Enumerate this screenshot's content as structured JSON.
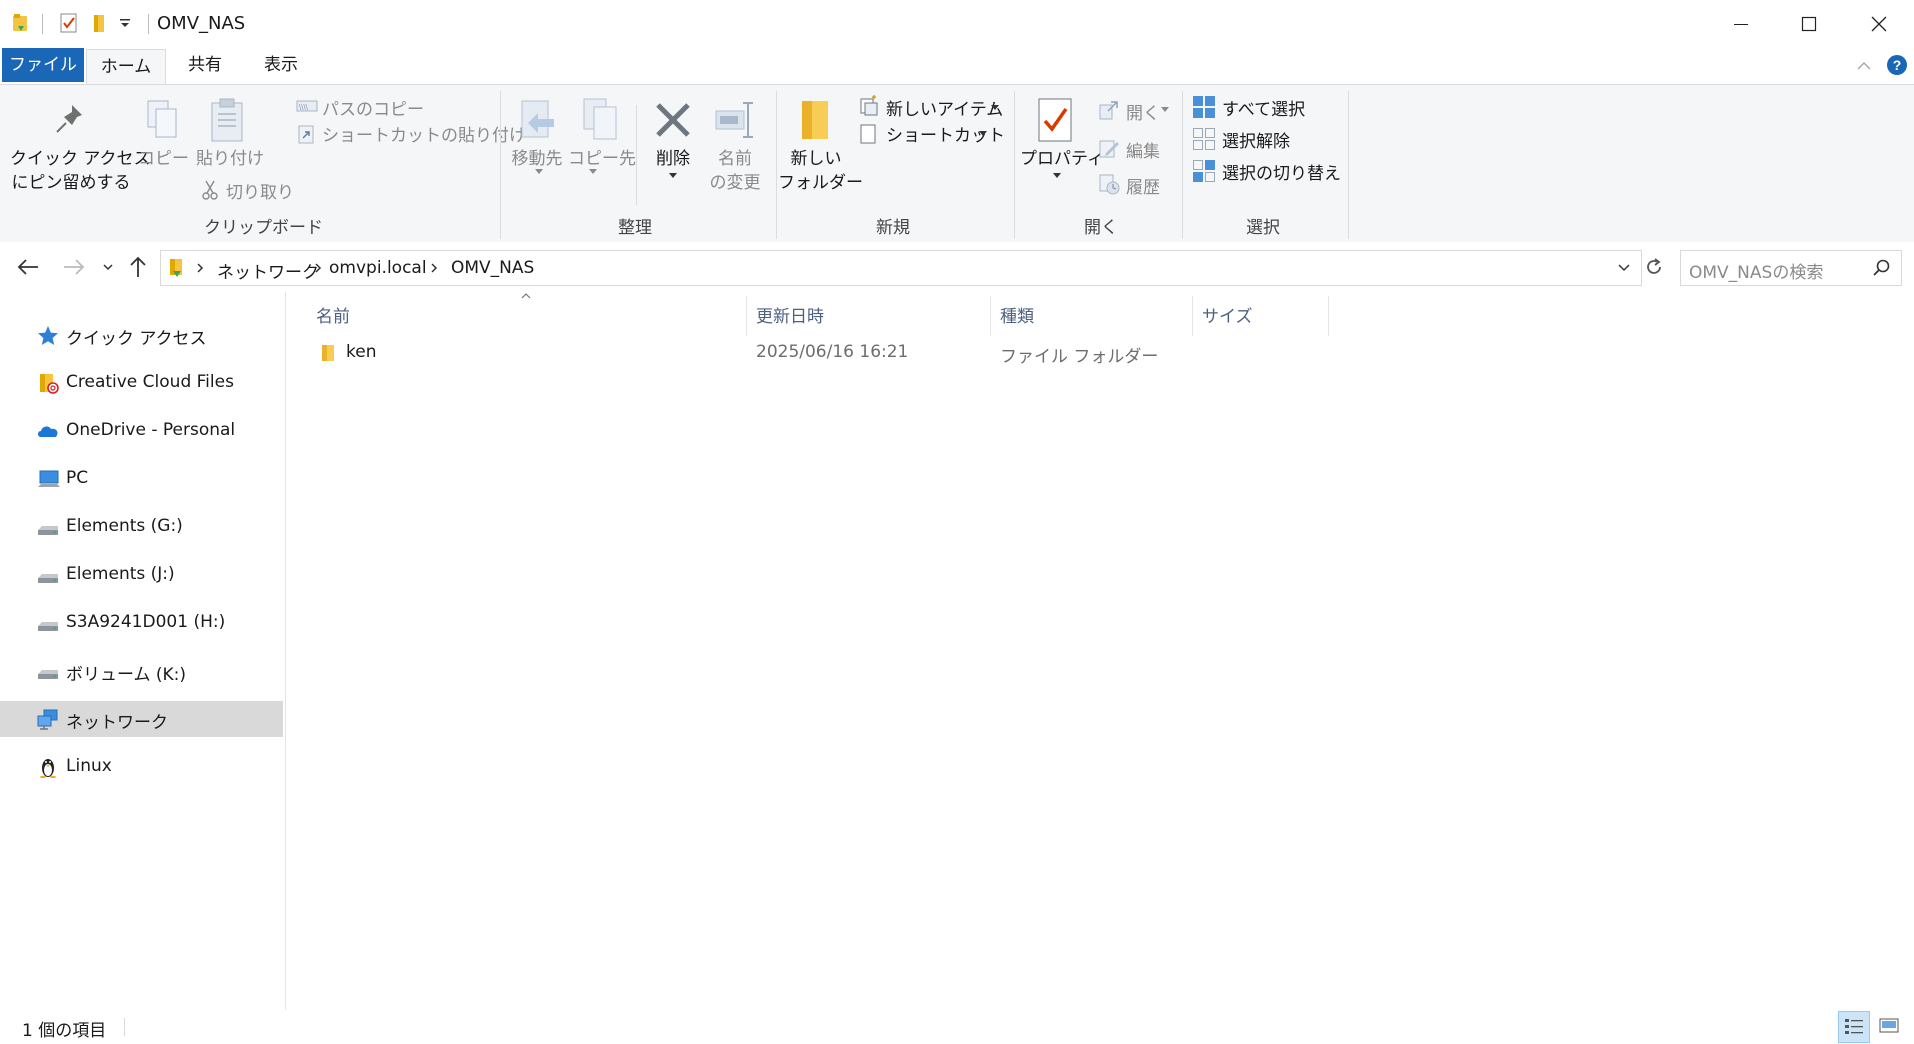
{
  "window": {
    "title": "OMV_NAS"
  },
  "tabs": {
    "file": "ファイル",
    "home": "ホーム",
    "share": "共有",
    "view": "表示"
  },
  "ribbon": {
    "clipboard": {
      "pin_label_1": "クイック アクセス",
      "pin_label_2": "にピン留めする",
      "copy": "コピー",
      "paste": "貼り付け",
      "copy_path": "パスのコピー",
      "paste_shortcut": "ショートカットの貼り付け",
      "cut": "切り取り",
      "group": "クリップボード"
    },
    "organize": {
      "move_to": "移動先",
      "copy_to": "コピー先",
      "delete": "削除",
      "rename_1": "名前",
      "rename_2": "の変更",
      "group": "整理"
    },
    "new": {
      "new_folder_1": "新しい",
      "new_folder_2": "フォルダー",
      "new_item": "新しいアイテム",
      "easy_access": "ショートカット",
      "group": "新規"
    },
    "open": {
      "properties": "プロパティ",
      "open": "開く",
      "edit": "編集",
      "history": "履歴",
      "group": "開く"
    },
    "select": {
      "select_all": "すべて選択",
      "select_none": "選択解除",
      "invert": "選択の切り替え",
      "group": "選択"
    }
  },
  "address": {
    "crumbs": [
      "ネットワーク",
      "omvpi.local",
      "OMV_NAS"
    ],
    "search_placeholder": "OMV_NASの検索"
  },
  "nav": {
    "items": [
      {
        "label": "クイック アクセス",
        "icon": "star-icon"
      },
      {
        "label": "Creative Cloud Files",
        "icon": "creative-cloud-folder-icon"
      },
      {
        "label": "OneDrive - Personal",
        "icon": "onedrive-icon"
      },
      {
        "label": "PC",
        "icon": "pc-icon"
      },
      {
        "label": "Elements (G:)",
        "icon": "drive-icon"
      },
      {
        "label": "Elements (J:)",
        "icon": "drive-icon"
      },
      {
        "label": "S3A9241D001 (H:)",
        "icon": "drive-icon"
      },
      {
        "label": "ボリューム (K:)",
        "icon": "drive-icon"
      },
      {
        "label": "ネットワーク",
        "icon": "network-icon",
        "selected": true
      },
      {
        "label": "Linux",
        "icon": "linux-penguin-icon"
      }
    ]
  },
  "columns": {
    "name": "名前",
    "modified": "更新日時",
    "type": "種類",
    "size": "サイズ"
  },
  "files": [
    {
      "name": "ken",
      "modified": "2025/06/16 16:21",
      "type": "ファイル フォルダー",
      "size": ""
    }
  ],
  "status": {
    "count": "1 個の項目"
  },
  "colors": {
    "accent": "#1a66b7",
    "selected": "#d9d9d9",
    "folder": "#f4c542"
  }
}
